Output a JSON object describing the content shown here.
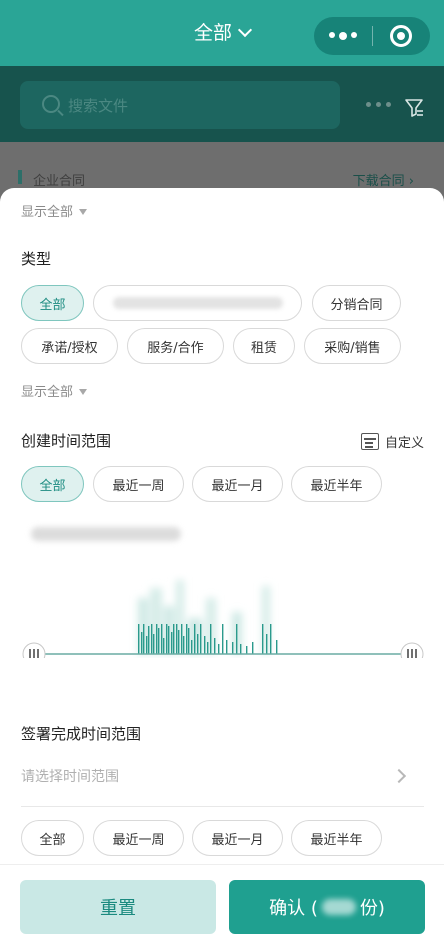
{
  "header": {
    "title": "全部",
    "more_icon": "more-dots-icon",
    "target_icon": "target-icon"
  },
  "search": {
    "placeholder": "搜索文件"
  },
  "list_header": {
    "section": "企业合同",
    "download": "下载合同 ›"
  },
  "filters": {
    "show_all_top": "显示全部",
    "type": {
      "title": "类型",
      "chips": [
        "全部",
        "",
        "分销合同",
        "承诺/授权",
        "服务/合作",
        "租赁",
        "采购/销售"
      ],
      "active_index": 0
    },
    "show_all_mid": "显示全部",
    "create_time": {
      "title": "创建时间范围",
      "custom_label": "自定义",
      "chips": [
        "全部",
        "最近一周",
        "最近一月",
        "最近半年"
      ],
      "active_index": 0
    },
    "sign_time": {
      "title": "签署完成时间范围",
      "placeholder": "请选择时间范围",
      "chips": [
        "全部",
        "最近一周",
        "最近一月",
        "最近半年"
      ]
    }
  },
  "actions": {
    "reset": "重置",
    "confirm_prefix": "确认 (",
    "confirm_suffix": "份)"
  },
  "colors": {
    "accent": "#1fa090",
    "accent_light": "#dff1ef"
  }
}
